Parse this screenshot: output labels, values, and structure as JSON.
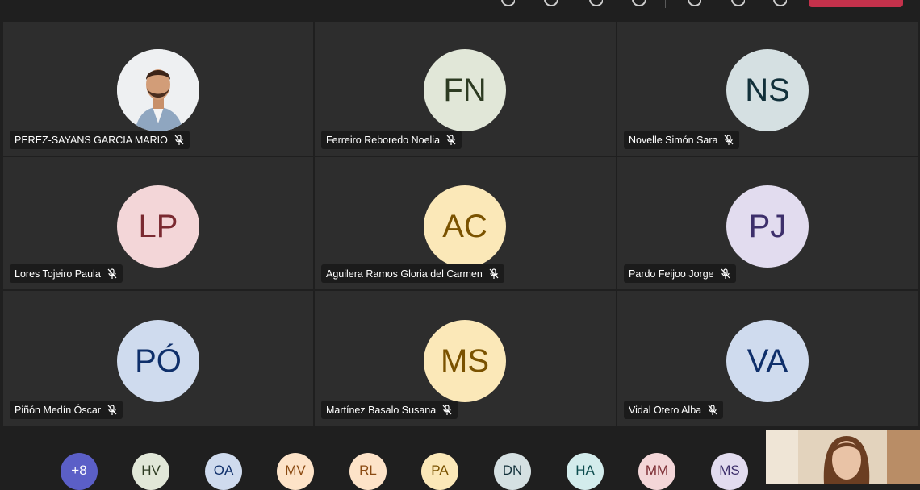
{
  "toolbar": {
    "icons": [
      "camera-icon",
      "chat-icon",
      "reactions-icon",
      "more-icon",
      "share-icon",
      "raise-hand-icon"
    ],
    "leave_color": "#c4314b"
  },
  "participants": [
    {
      "name": "PEREZ-SAYANS GARCIA MARIO",
      "initials": "",
      "photo": true,
      "muted": true
    },
    {
      "name": "Ferreiro Reboredo Noelia",
      "initials": "FN",
      "bg": "#e1e7d8",
      "fg": "#2d3b22",
      "muted": true
    },
    {
      "name": "Novelle Simón Sara",
      "initials": "NS",
      "bg": "#d5e0e2",
      "fg": "#12303a",
      "muted": true
    },
    {
      "name": "Lores Tojeiro Paula",
      "initials": "LP",
      "bg": "#f3d6d8",
      "fg": "#7a2a31",
      "muted": true
    },
    {
      "name": "Aguilera Ramos Gloria del Carmen",
      "initials": "AC",
      "bg": "#fbe8b8",
      "fg": "#7a5200",
      "muted": true
    },
    {
      "name": "Pardo Feijoo Jorge",
      "initials": "PJ",
      "bg": "#e2dcef",
      "fg": "#3d2f6b",
      "muted": true
    },
    {
      "name": "Piñón Medín Óscar",
      "initials": "PÓ",
      "bg": "#cfdbee",
      "fg": "#0f2f6a",
      "muted": true
    },
    {
      "name": "Martínez Basalo Susana",
      "initials": "MS",
      "bg": "#fbe8b8",
      "fg": "#7a5200",
      "muted": true
    },
    {
      "name": "Vidal Otero Alba",
      "initials": "VA",
      "bg": "#cfdbee",
      "fg": "#0f2f6a",
      "muted": true
    }
  ],
  "overflow": [
    {
      "initials": "+8",
      "bg": "#5b5fc7",
      "fg": "#ffffff"
    },
    {
      "initials": "HV",
      "bg": "#e1e7d8",
      "fg": "#2d3b22"
    },
    {
      "initials": "OA",
      "bg": "#cfdbee",
      "fg": "#0f2f6a"
    },
    {
      "initials": "MV",
      "bg": "#fde3c8",
      "fg": "#8a4a12"
    },
    {
      "initials": "RL",
      "bg": "#fde3c8",
      "fg": "#8a4a12"
    },
    {
      "initials": "PA",
      "bg": "#fbe8b8",
      "fg": "#7a5200"
    },
    {
      "initials": "DN",
      "bg": "#d5e0e2",
      "fg": "#12303a"
    },
    {
      "initials": "HA",
      "bg": "#d3ecec",
      "fg": "#0d4d4f"
    },
    {
      "initials": "MM",
      "bg": "#f3d6d8",
      "fg": "#7a2a31"
    },
    {
      "initials": "MS",
      "bg": "#e2dcef",
      "fg": "#3d2f6b"
    }
  ]
}
